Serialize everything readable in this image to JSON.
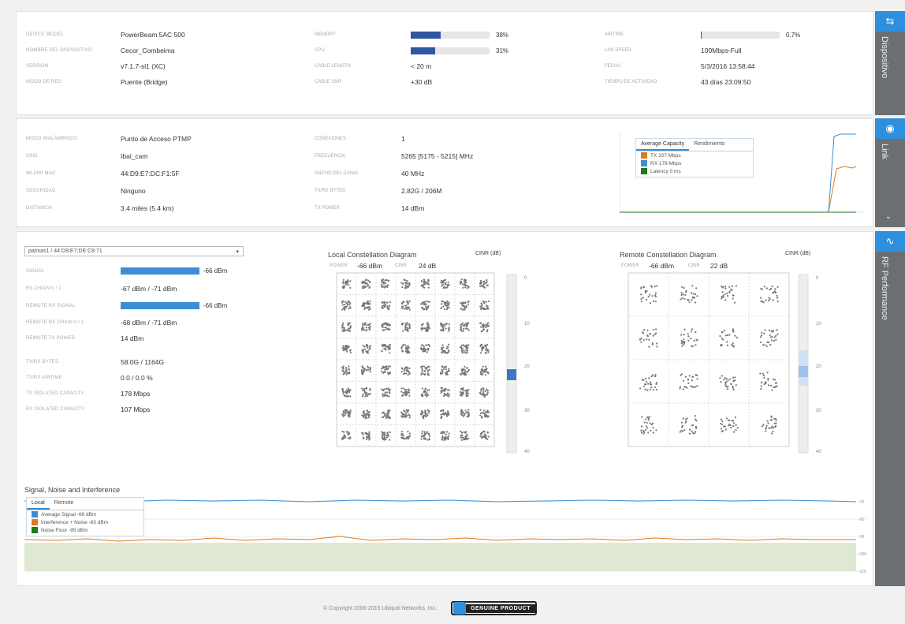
{
  "device": {
    "rows": [
      {
        "label": "DEVICE MODEL",
        "value": "PowerBeam 5AC 500"
      },
      {
        "label": "NOMBRE DEL DISPOSITIVO",
        "value": "Cecor_Combeima"
      },
      {
        "label": "VERSIÓN",
        "value": "v7.1.7-sl1 (XC)"
      },
      {
        "label": "MODO DE RED",
        "value": "Puente (Bridge)"
      }
    ],
    "memory": {
      "label": "MEMORY",
      "value": "38%",
      "level": 0.38
    },
    "cpu": {
      "label": "CPU",
      "value": "31%",
      "level": 0.31
    },
    "cable_length": {
      "label": "CABLE LENGTH",
      "value": "< 20 m"
    },
    "cable_snr": {
      "label": "CABLE SNR",
      "value": "+30 dB"
    },
    "airtime": {
      "label": "AIRTIME",
      "value": "0.7%",
      "level": 0.007
    },
    "lan_speed": {
      "label": "LAN SPEED",
      "value": "100Mbps-Full"
    },
    "fecha": {
      "label": "FECHA",
      "value": "5/3/2016 13:58:44"
    },
    "uptime": {
      "label": "TIEMPO DE ACTIVIDAD",
      "value": "43 días 23:09:50"
    },
    "tab_label": "Dispositivo",
    "tab_icon": "device-icon"
  },
  "link": {
    "rows": [
      {
        "label": "MODO INALÁMBRICO",
        "value": "Punto de Acceso PTMP"
      },
      {
        "label": "SSID",
        "value": "Ibal_cam"
      },
      {
        "label": "WLAN0 MAC",
        "value": "44:D9:E7:DC:F1:5F"
      },
      {
        "label": "SEGURIDAD",
        "value": "Ninguno"
      },
      {
        "label": "DISTANCIA",
        "value": "3.4 miles (5.4 km)"
      }
    ],
    "rows2": [
      {
        "label": "CONEXIONES",
        "value": "1"
      },
      {
        "label": "FRECUENCIA",
        "value": "5265 [5175 - 5215] MHz"
      },
      {
        "label": "ANCHO DEL CANAL",
        "value": "40 MHz"
      },
      {
        "label": "TX/RX BYTES",
        "value": "2.82G / 206M"
      },
      {
        "label": "TX POWER",
        "value": "14 dBm"
      }
    ],
    "legend": {
      "tabs": [
        "Average Capacity",
        "Rendimiento"
      ],
      "items": [
        {
          "label": "TX 107 Mbps",
          "color": "#e07b1a"
        },
        {
          "label": "RX 178 Mbps",
          "color": "#3b8fd6"
        },
        {
          "label": "Latency 0 ms",
          "color": "#1f7a1f"
        }
      ]
    },
    "tab_label": "Link",
    "tab_icon": "wifi-icon"
  },
  "rf": {
    "station": "palmas1 / 44:D9:E7:DE:C8:71",
    "rows": [
      {
        "label": "SIGNAL",
        "value": "-66 dBm",
        "bar": 0.7
      },
      {
        "label": "RX CHAIN 0 / 1",
        "value": "-67 dBm / -71 dBm"
      },
      {
        "label": "REMOTE RX SIGNAL",
        "value": "-66 dBm",
        "bar": 0.7
      },
      {
        "label": "REMOTE RX CHAIN 0 / 1",
        "value": "-68 dBm / -71 dBm"
      },
      {
        "label": "REMOTE TX POWER",
        "value": "14 dBm"
      },
      {
        "label": "TX/RX BYTES",
        "value": "58.0G / 1164G"
      },
      {
        "label": "TX/RX AIRTIME",
        "value": "0.0 / 0.0 %"
      },
      {
        "label": "TX ISOLATED CAPACITY",
        "value": "178 Mbps"
      },
      {
        "label": "RX ISOLATED CAPACITY",
        "value": "107 Mbps"
      }
    ],
    "local": {
      "title": "Local Constellation Diagram",
      "cinr_label": "CINR (dB)",
      "power_label": "POWER",
      "power_value": "-66 dBm",
      "cinr_short": "CINR",
      "cinr_value": "24 dB"
    },
    "remote": {
      "title": "Remote Constellation Diagram",
      "cinr_label": "CINR (dB)",
      "power_label": "POWER",
      "power_value": "-66 dBm",
      "cinr_short": "CINR",
      "cinr_value": "22 dB"
    },
    "sni": {
      "title": "Signal, Noise and Interference",
      "tabs": [
        "Local",
        "Remote"
      ],
      "items": [
        {
          "label": "Average Signal -66 dBm",
          "color": "#3b8fd6"
        },
        {
          "label": "Interference + Noise -83 dBm",
          "color": "#e07b1a"
        },
        {
          "label": "Noise Floor -95 dBm",
          "color": "#1f7a1f"
        }
      ]
    },
    "tab_label": "RF Performance",
    "tab_icon": "rf-icon"
  },
  "footer": {
    "copyright": "© Copyright 2006-2015 Ubiquiti Networks, Inc.",
    "badge": "GENUINE PRODUCT"
  }
}
